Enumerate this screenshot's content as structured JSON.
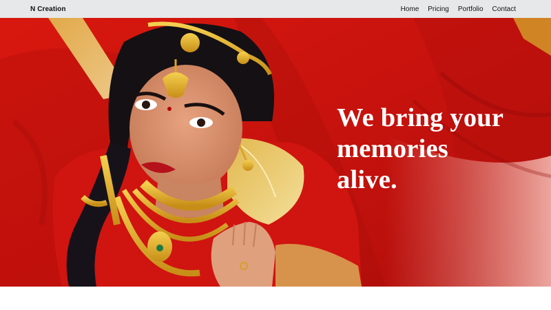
{
  "navbar": {
    "brand": "N Creation",
    "links": [
      {
        "label": "Home"
      },
      {
        "label": "Pricing"
      },
      {
        "label": "Portfolio"
      },
      {
        "label": "Contact"
      }
    ]
  },
  "hero": {
    "headline_lines": [
      "We bring your",
      "memories",
      "alive."
    ],
    "colors": {
      "background_red": "#c8140f",
      "text": "#ffffff",
      "navbar": "#e7e8e9"
    }
  }
}
